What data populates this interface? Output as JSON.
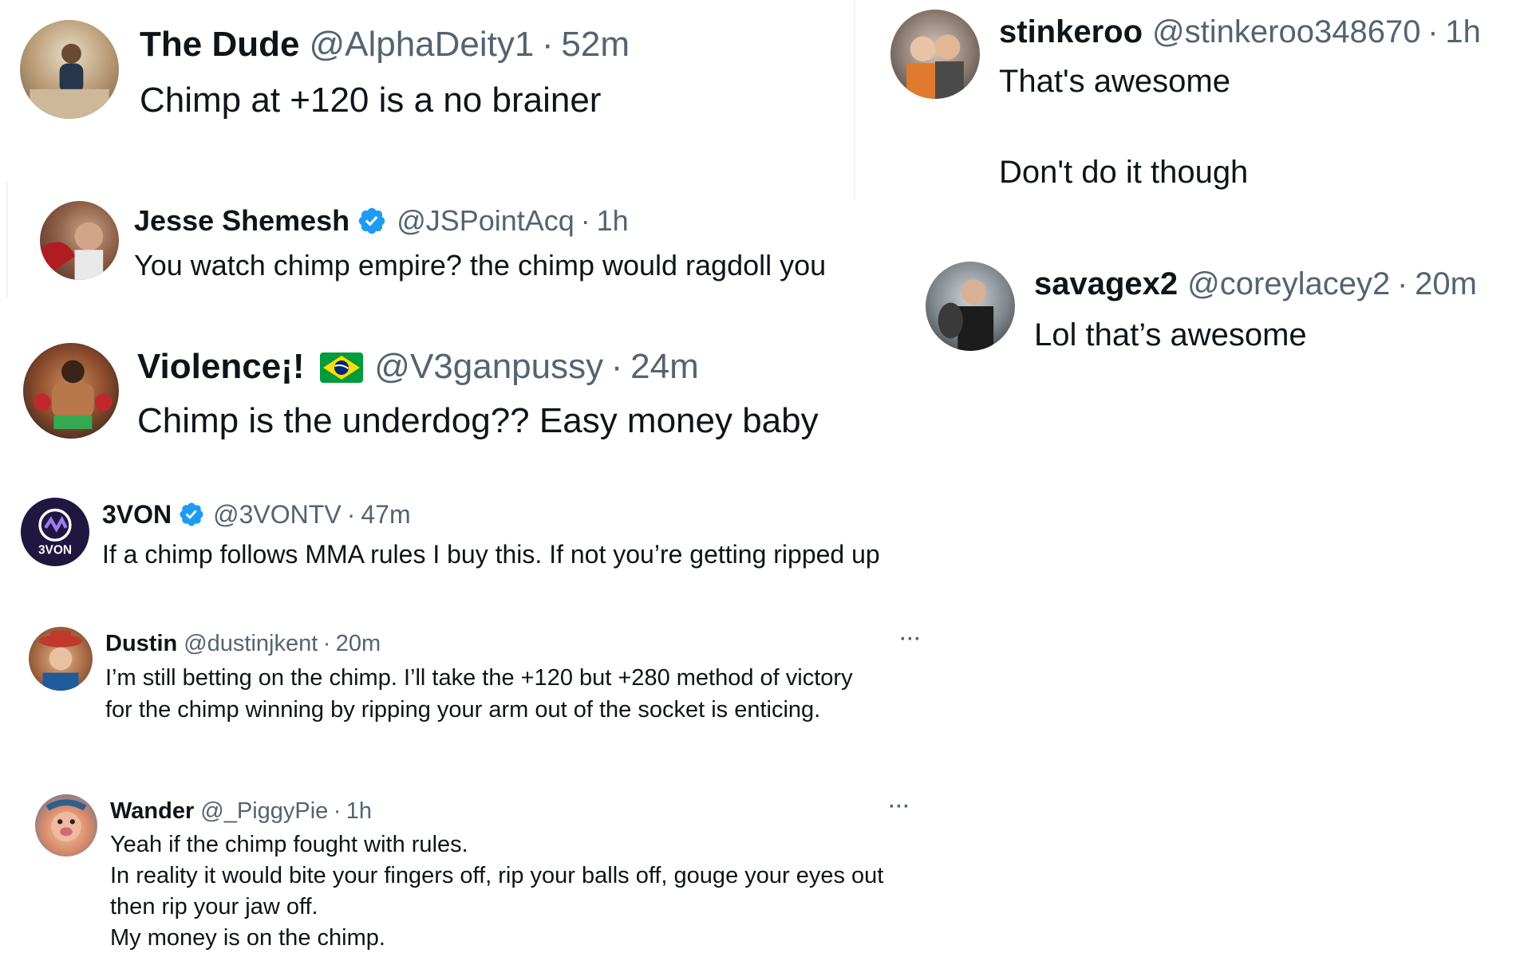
{
  "tweets": [
    {
      "name": "The Dude",
      "handle": "@AlphaDeity1",
      "time": "52m",
      "body": [
        "Chimp at +120 is a no brainer"
      ]
    },
    {
      "name": "Jesse Shemesh",
      "handle": "@JSPointAcq",
      "time": "1h",
      "verified": true,
      "body": [
        "You watch chimp empire?  the chimp would ragdoll you"
      ]
    },
    {
      "name": "Violence¡!",
      "handle": "@V3ganpussy",
      "time": "24m",
      "flag": "brazil-flag",
      "body": [
        "Chimp is the underdog?? Easy money baby"
      ]
    },
    {
      "name": "3VON",
      "handle": "@3VONTV",
      "time": "47m",
      "verified": true,
      "avatar_text": "3VON",
      "body": [
        "If a chimp follows MMA rules I buy this. If not you’re getting ripped up"
      ]
    },
    {
      "name": "Dustin",
      "handle": "@dustinjkent",
      "time": "20m",
      "more": "···",
      "body": [
        "I’m still betting on the chimp. I’ll take the +120 but +280 method of victory",
        "for the chimp winning by ripping your arm out of the socket is enticing."
      ]
    },
    {
      "name": "Wander",
      "handle": "@_PiggyPie",
      "time": "1h",
      "more": "···",
      "body": [
        "Yeah if the chimp fought with rules.",
        "In reality it would bite your fingers off, rip your balls off, gouge your eyes out",
        "then rip your jaw off.",
        "My money is on the chimp."
      ]
    },
    {
      "name": "stinkeroo",
      "handle": "@stinkeroo348670",
      "time": "1h",
      "body": [
        "That's awesome",
        "Don't do it though"
      ]
    },
    {
      "name": "savagex2",
      "handle": "@coreylacey2",
      "time": "20m",
      "body": [
        "Lol that’s awesome"
      ]
    }
  ],
  "separator": "·",
  "colors": {
    "text": "#0f1419",
    "secondary": "#536471",
    "verified": "#1d9bf0"
  }
}
